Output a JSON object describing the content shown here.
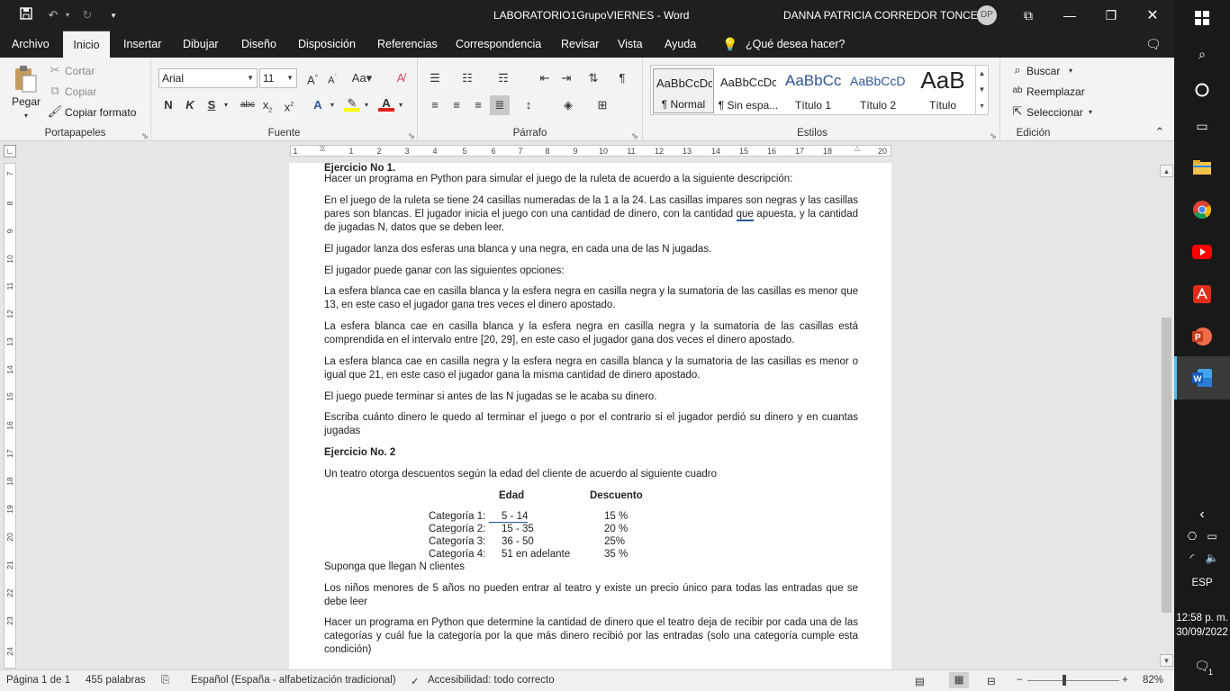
{
  "titlebar": {
    "doc_title": "LABORATORIO1GrupoVIERNES  -  Word",
    "user_name": "DANNA PATRICIA CORREDOR TONCEL",
    "user_initials": "DP"
  },
  "tabs": [
    "Archivo",
    "Inicio",
    "Insertar",
    "Dibujar",
    "Diseño",
    "Disposición",
    "Referencias",
    "Correspondencia",
    "Revisar",
    "Vista",
    "Ayuda"
  ],
  "tell_me": "¿Qué desea hacer?",
  "ribbon": {
    "clipboard": {
      "paste": "Pegar",
      "cut": "Cortar",
      "copy": "Copiar",
      "format_painter": "Copiar formato",
      "label": "Portapapeles"
    },
    "font": {
      "name": "Arial",
      "size": "11",
      "label": "Fuente"
    },
    "paragraph": {
      "label": "Párrafo"
    },
    "styles": {
      "label": "Estilos",
      "items": [
        {
          "preview": "AaBbCcDc",
          "name": "¶ Normal"
        },
        {
          "preview": "AaBbCcDc",
          "name": "¶ Sin espa..."
        },
        {
          "preview": "AaBbCc",
          "name": "Título 1"
        },
        {
          "preview": "AaBbCcD",
          "name": "Título 2"
        },
        {
          "preview": "AaB",
          "name": "Título"
        }
      ]
    },
    "editing": {
      "find": "Buscar",
      "replace": "Reemplazar",
      "select": "Seleccionar",
      "label": "Edición"
    }
  },
  "ruler": {
    "h_ticks": [
      "1",
      "1",
      "2",
      "3",
      "4",
      "5",
      "6",
      "7",
      "8",
      "9",
      "10",
      "11",
      "12",
      "13",
      "14",
      "15",
      "16",
      "17",
      "18",
      "20"
    ],
    "v_ticks": [
      "7",
      "8",
      "9",
      "10",
      "11",
      "12",
      "13",
      "14",
      "15",
      "16",
      "17",
      "18",
      "19",
      "20",
      "21",
      "22",
      "23",
      "24"
    ]
  },
  "document": {
    "ex1_title": "Ejercicio No 1.",
    "p1": "Hacer un programa en Python para simular el juego de la ruleta de acuerdo a la siguiente descripción:",
    "p2": "En el juego de la ruleta se tiene 24 casillas numeradas de la 1 a la 24. Las casillas impares son negras y las casillas pares son blancas. El jugador inicia el juego con una cantidad de dinero, con la cantidad que apuesta, y la cantidad de jugadas N, datos que se deben leer.",
    "p3": "El jugador lanza dos esferas una blanca y una negra, en cada una de las N jugadas.",
    "p4": "El jugador puede ganar con las siguientes opciones:",
    "p5": "La esfera blanca cae en casilla blanca y la esfera negra en casilla negra y la sumatoria de las casillas es menor que 13, en este caso el jugador gana tres veces el dinero apostado.",
    "p6": "La esfera blanca cae en casilla blanca y la esfera negra en casilla negra y la sumatoria de las casillas está comprendida en el intervalo entre [20, 29], en este caso el jugador gana dos veces el dinero apostado.",
    "p7": "La esfera blanca cae en casilla negra y la esfera negra en casilla blanca y la sumatoria de las casillas es menor o igual que 21, en este caso el jugador gana la misma cantidad de dinero apostado.",
    "p8": "El juego puede terminar si antes de las N jugadas se le acaba su dinero.",
    "p9": "Escriba cuánto dinero le quedo al terminar el juego o por el contrario si el jugador perdió su dinero y en cuantas jugadas",
    "ex2_title": "Ejercicio No. 2",
    "p10": "Un teatro otorga descuentos según la edad del cliente de acuerdo al siguiente cuadro",
    "table": {
      "headers": [
        "Edad",
        "Descuento"
      ],
      "rows": [
        {
          "cat": "Categoría 1:",
          "edad": "5  - 14",
          "desc": "15 %"
        },
        {
          "cat": "Categoría 2:",
          "edad": "15 - 35",
          "desc": "20 %"
        },
        {
          "cat": "Categoría 3:",
          "edad": "36 - 50",
          "desc": "25%"
        },
        {
          "cat": "Categoría 4:",
          "edad": "51 en adelante",
          "desc": "35 %"
        }
      ]
    },
    "p11": "Suponga que llegan N clientes",
    "p12": "Los niños menores de 5 años no pueden entrar al teatro y existe un precio único para todas las entradas que se debe leer",
    "p13": "Hacer un programa en Python que determine la cantidad de dinero que el teatro deja de recibir por cada una de las categorías y cuál fue la categoría por la que más dinero recibió por las entradas (solo una categoría cumple esta condición)"
  },
  "status": {
    "page": "Página 1 de 1",
    "words": "455 palabras",
    "language": "Español (España - alfabetización tradicional)",
    "accessibility": "Accesibilidad: todo correcto",
    "zoom": "82%",
    "zoom_level": 0.82
  },
  "taskbar": {
    "time": "12:58 p. m.",
    "date": "30/09/2022",
    "lang": "ESP",
    "notifications": "1"
  },
  "colors": {
    "titlebar": "#1f1f1f",
    "ribbon": "#f3f3f3",
    "canvas": "#e6e6e6",
    "word_blue": "#2b579a"
  }
}
